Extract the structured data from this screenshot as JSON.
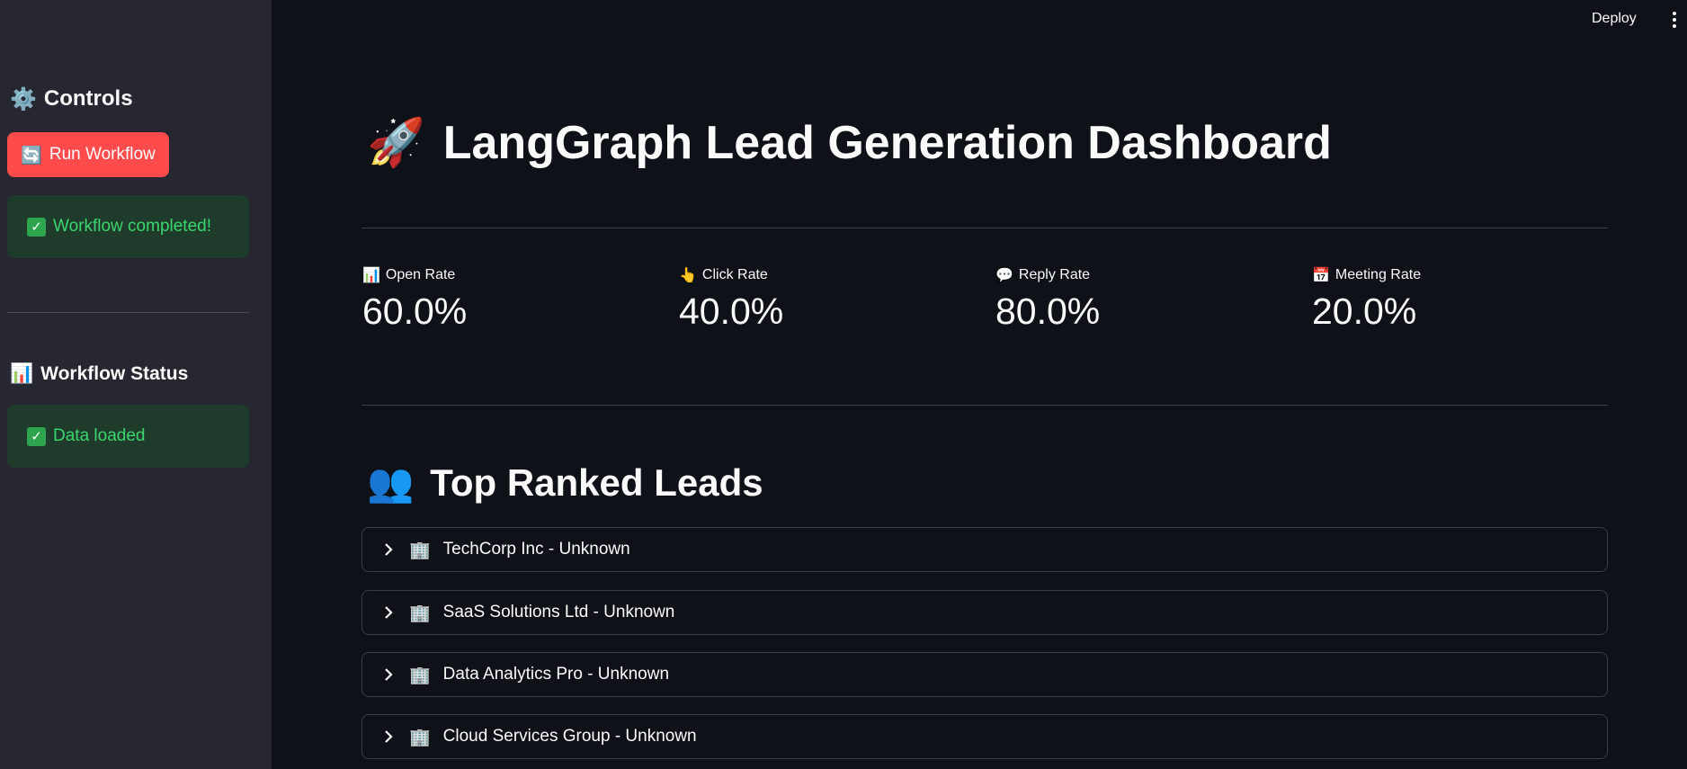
{
  "topbar": {
    "deploy_label": "Deploy"
  },
  "sidebar": {
    "controls_heading": "Controls",
    "controls_icon": "⚙️",
    "run_button_icon": "🔄",
    "run_button_label": "Run Workflow",
    "workflow_alert": "Workflow completed!",
    "status_heading": "Workflow Status",
    "status_icon": "📊",
    "status_alert": "Data loaded"
  },
  "main": {
    "title": "LangGraph Lead Generation Dashboard",
    "title_icon": "🚀",
    "metrics": [
      {
        "icon": "📊",
        "label": "Open Rate",
        "value": "60.0%"
      },
      {
        "icon": "👆",
        "label": "Click Rate",
        "value": "40.0%"
      },
      {
        "icon": "💬",
        "label": "Reply Rate",
        "value": "80.0%"
      },
      {
        "icon": "📅",
        "label": "Meeting Rate",
        "value": "20.0%"
      }
    ],
    "leads_title": "Top Ranked Leads",
    "leads_icon": "👥",
    "leads": [
      {
        "icon": "🏢",
        "label": "TechCorp Inc - Unknown"
      },
      {
        "icon": "🏢",
        "label": "SaaS Solutions Ltd - Unknown"
      },
      {
        "icon": "🏢",
        "label": "Data Analytics Pro - Unknown"
      },
      {
        "icon": "🏢",
        "label": "Cloud Services Group - Unknown"
      }
    ]
  },
  "colors": {
    "background": "#0e1117",
    "sidebar": "#262730",
    "primary_button": "#ff4b4b",
    "success_bg": "#1f3b2c",
    "success_text": "#3dd56d"
  }
}
